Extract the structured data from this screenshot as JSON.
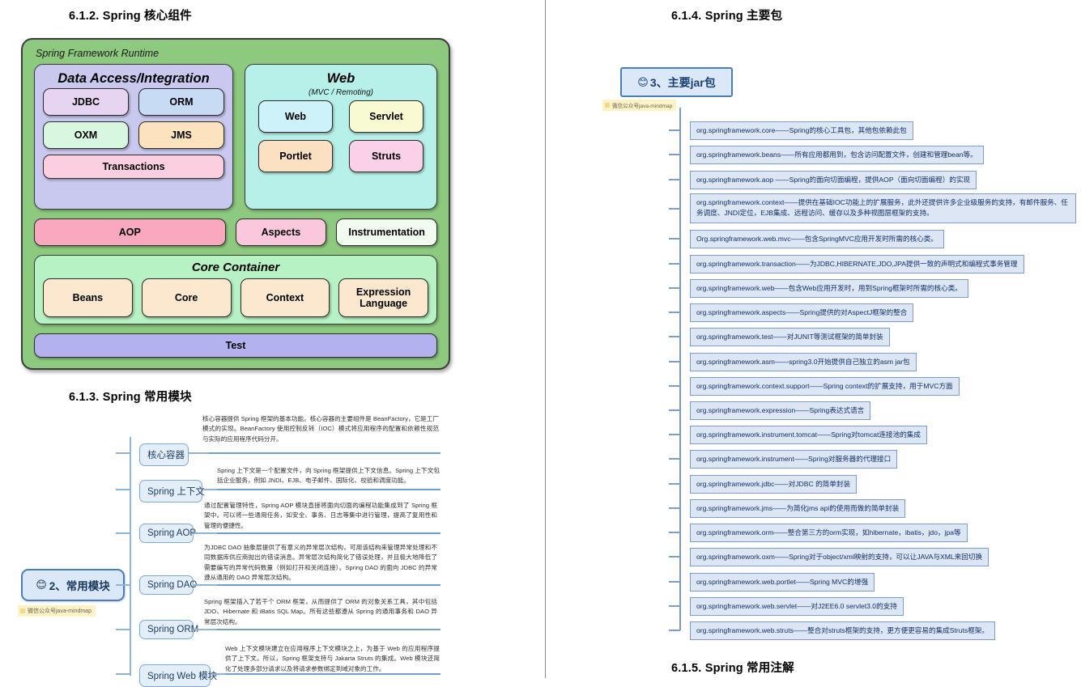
{
  "left": {
    "heading_core": "6.1.2.  Spring 核心组件",
    "heading_modules": "6.1.3.  Spring 常用模块",
    "framework": {
      "runtime_title": "Spring Framework Runtime",
      "data_access": {
        "title": "Data Access/Integration",
        "cells": [
          "JDBC",
          "ORM",
          "OXM",
          "JMS",
          "Transactions"
        ]
      },
      "web": {
        "title": "Web",
        "subtitle": "(MVC / Remoting)",
        "cells": [
          "Web",
          "Servlet",
          "Portlet",
          "Struts"
        ]
      },
      "middle_row": [
        "AOP",
        "Aspects",
        "Instrumentation"
      ],
      "core_container": {
        "title": "Core Container",
        "cells": [
          "Beans",
          "Core",
          "Context",
          "Expression Language"
        ]
      },
      "test": "Test"
    },
    "mindmap": {
      "badge_emoji": "😊",
      "badge_label": "2、常用模块",
      "note": "微信公众号java-mindmap",
      "nodes": [
        {
          "label": "核心容器",
          "text": "核心容器提供 Spring 框架的基本功能。核心容器的主要组件是 BeanFactory，它是工厂模式的实现。BeanFactory 使用控制反转（IOC）模式将应用程序的配置和依赖性规范与实际的应用程序代码分开。"
        },
        {
          "label": "Spring 上下文",
          "text": "Spring 上下文是一个配置文件，向 Spring 框架提供上下文信息。Spring 上下文包括企业服务，例如 JNDI、EJB、电子邮件、国际化、校验和调度功能。"
        },
        {
          "label": "Spring AOP",
          "text": "通过配置管理特性，Spring AOP 模块直接将面向切面的编程功能集成到了 Spring 框架中。可以将一些通用任务，如安全、事务、日志等集中进行管理，提高了复用性和管理的便捷性。"
        },
        {
          "label": "Spring DAO",
          "text": "为JDBC DAO 抽象层提供了有意义的异常层次结构，可用该结构来管理异常处理和不同数据库供应商抛出的错误消息。异常层次结构简化了错误处理，并且极大地降低了需要编写的异常代码数量（例如打开和关闭连接）。Spring DAO 的面向 JDBC 的异常遵从通用的 DAO 异常层次结构。"
        },
        {
          "label": "Spring ORM",
          "text": "Spring 框架插入了若干个 ORM 框架，从而提供了 ORM 的对象关系工具，其中包括 JDO、Hibernate 和 iBatis SQL Map。所有这些都遵从 Spring 的通用事务和 DAO 异常层次结构。"
        },
        {
          "label": "Spring Web 模块",
          "text": "Web 上下文模块建立在应用程序上下文模块之上，为基于 Web 的应用程序提供了上下文。所以，Spring 框架支持与 Jakarta Struts 的集成。Web 模块还简化了处理多部分请求以及将请求参数绑定到域对象的工作。"
        }
      ]
    }
  },
  "right": {
    "heading_packages": "6.1.4.  Spring 主要包",
    "heading_annotations": "6.1.5.  Spring 常用注解",
    "badge_emoji": "😊",
    "badge_label": "3、主要jar包",
    "note": "微信公众号java-mindmap",
    "jars": [
      "org.springframework.core——Spring的核心工具包，其他包依赖此包",
      "org.springframework.beans——所有应用都用到，包含访问配置文件，创建和管理bean等。",
      "org.springframework.aop ——Spring的面向切面编程，提供AOP（面向切面编程）的实现",
      "org.springframework.context——提供在基础IOC功能上的扩展服务，此外还提供许多企业级服务的支持，有邮件服务、任务调度、JNDI定位，EJB集成、远程访问、缓存以及多种视图层框架的支持。",
      "Org.springframework.web.mvc——包含SpringMVC应用开发时所需的核心类。",
      "org.springframework.transaction——为JDBC,HIBERNATE,JDO,JPA提供一致的声明式和编程式事务管理",
      "org.springframework.web——包含Web应用开发时，用到Spring框架时所需的核心类。",
      "org.springframework.aspects——Spring提供的对AspectJ框架的整合",
      "org.springframework.test——对JUNIT等测试框架的简单封装",
      "org.springframework.asm——spring3.0开始提供自己独立的asm jar包",
      "org.springframework.context.support——Spring context的扩展支持，用于MVC方面",
      "org.springframework.expression——Spring表达式语言",
      "org.springframework.instrument.tomcat——Spring对tomcat连接池的集成",
      "org.springframework.instrument——Spring对服务器的代理接口",
      "org.springframework.jdbc——对JDBC 的简单封装",
      "org.springframework.jms——为简化jms api的使用而做的简单封装",
      "org.springframework.orm——整合第三方的orm实现，如hibernate，ibatis，jdo，jpa等",
      "org.springframework.oxm——Spring对于object/xml映射的支持，可以让JAVA与XML来回切换",
      "org.springframework.web.portlet——Spring MVC的增强",
      "org.springframework.web.servlet——对J2EE6.0 servlet3.0的支持",
      "org.springframework.web.struts——整合对struts框架的支持，更方便更容易的集成Struts框架。"
    ]
  },
  "colors": {
    "runtime_green": "#8dc97f",
    "data_access_lavender": "#c9c9f0",
    "web_cyan": "#b6f0e8",
    "core_container_green": "#b7f2c4",
    "test_purple": "#b3b2ee",
    "aop_pink": "#f9a8c0",
    "jar_blue": "#dce6f4",
    "badge_border": "#4a7ebb"
  }
}
